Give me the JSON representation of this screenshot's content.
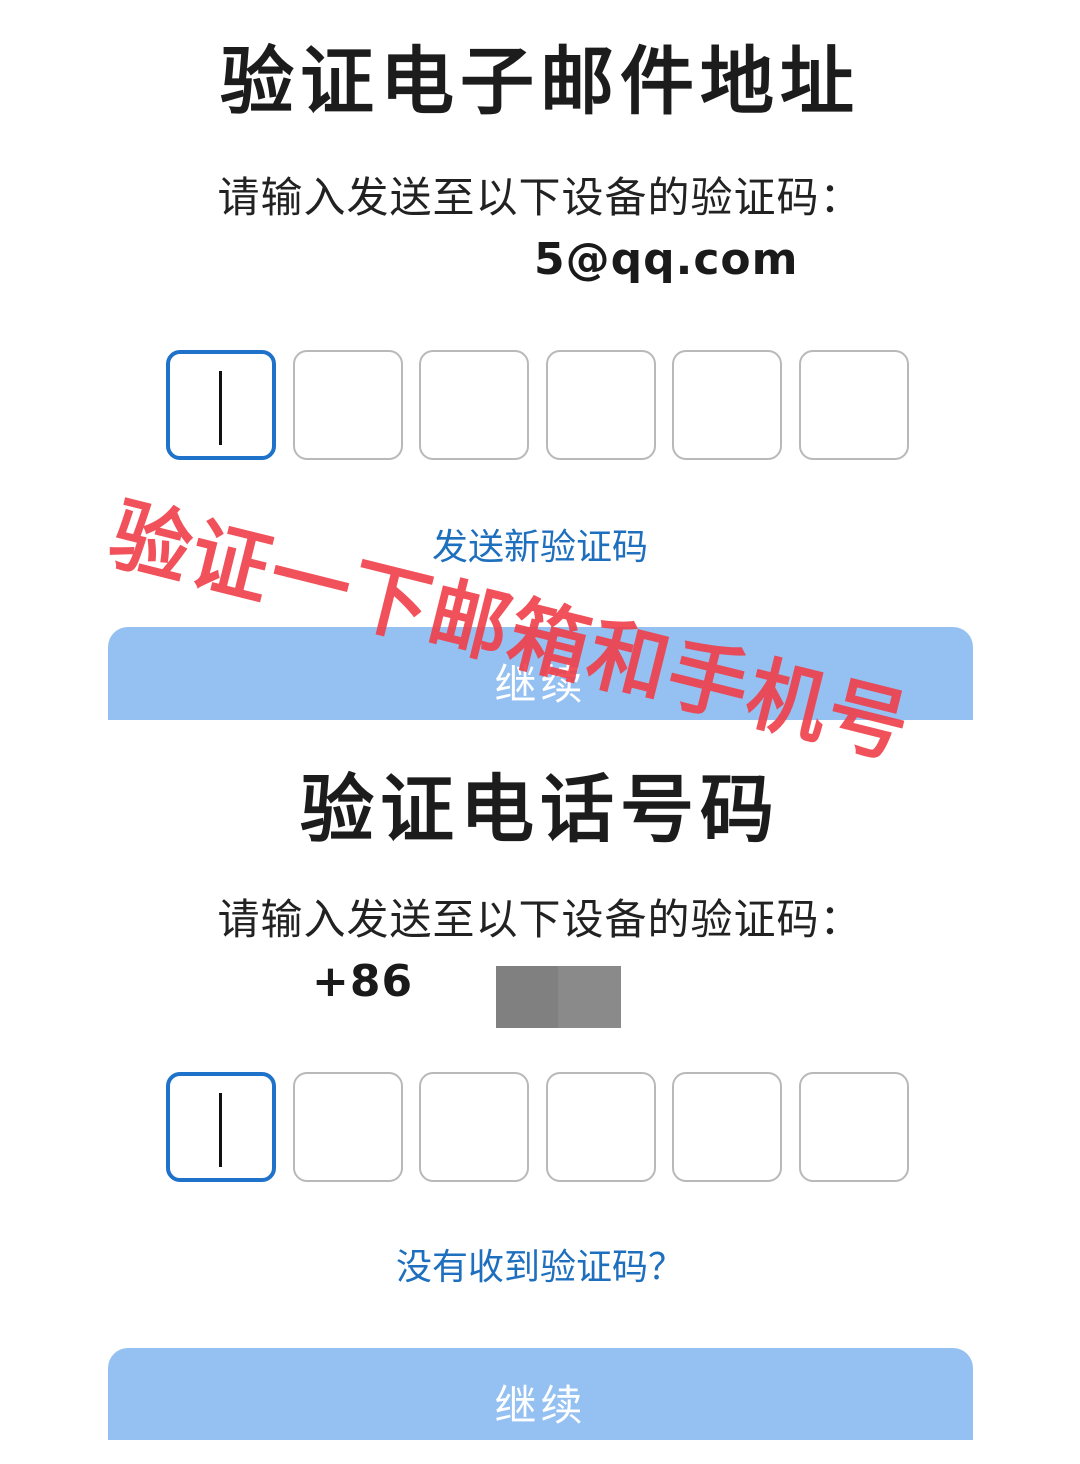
{
  "email_verification": {
    "title": "验证电子邮件地址",
    "prompt": "请输入发送至以下设备的验证码：",
    "destination": "5@qq.com",
    "code_box_count": 6,
    "resend_link": "发送新验证码",
    "continue_label": "继续"
  },
  "phone_verification": {
    "title": "验证电话号码",
    "prompt": "请输入发送至以下设备的验证码：",
    "destination": "+86",
    "code_box_count": 6,
    "help_link": "没有收到验证码？",
    "continue_label": "继续"
  },
  "overlay_caption": "验证一下邮箱和手机号",
  "colors": {
    "accent": "#1f72c9",
    "link": "#1f6fbf",
    "button_bg": "#94c1f1",
    "overlay_text": "#f03e48",
    "box_border": "#b9b9b9"
  }
}
